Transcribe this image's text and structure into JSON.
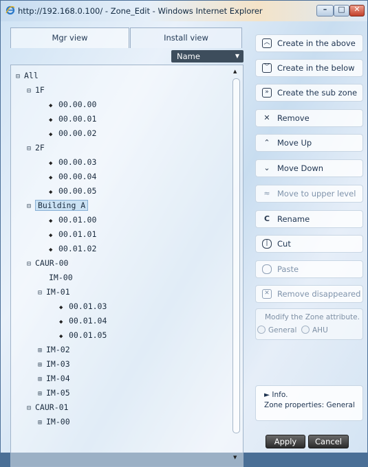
{
  "window": {
    "title": "http://192.168.0.100/ - Zone_Edit - Windows Internet Explorer"
  },
  "tabs": {
    "mgr": "Mgr view",
    "install": "Install view"
  },
  "sort": {
    "selected": "Name"
  },
  "tree": {
    "root": "All",
    "n_1F": "1F",
    "n_1F_0": "00.00.00",
    "n_1F_1": "00.00.01",
    "n_1F_2": "00.00.02",
    "n_2F": "2F",
    "n_2F_0": "00.00.03",
    "n_2F_1": "00.00.04",
    "n_2F_2": "00.00.05",
    "n_bA": "Building A",
    "n_bA_0": "00.01.00",
    "n_bA_1": "00.01.01",
    "n_bA_2": "00.01.02",
    "n_c0": "CAUR-00",
    "n_c0_im00": "IM-00",
    "n_c0_im01": "IM-01",
    "n_im01_0": "00.01.03",
    "n_im01_1": "00.01.04",
    "n_im01_2": "00.01.05",
    "n_c0_im02": "IM-02",
    "n_c0_im03": "IM-03",
    "n_c0_im04": "IM-04",
    "n_c0_im05": "IM-05",
    "n_c1": "CAUR-01",
    "n_c1_im00": "IM-00"
  },
  "actions": {
    "create_above": "Create in the above",
    "create_below": "Create in the below",
    "create_sub": "Create the sub zone",
    "remove": "Remove",
    "move_up": "Move Up",
    "move_down": "Move Down",
    "move_upper": "Move to upper level",
    "rename": "Rename",
    "cut": "Cut",
    "paste": "Paste",
    "remove_disappeared": "Remove disappeared"
  },
  "attribute": {
    "title": "Modify the Zone attribute.",
    "general": "General",
    "ahu": "AHU"
  },
  "info": {
    "heading": "► Info.",
    "properties": "Zone properties: General"
  },
  "buttons": {
    "apply": "Apply",
    "cancel": "Cancel"
  }
}
